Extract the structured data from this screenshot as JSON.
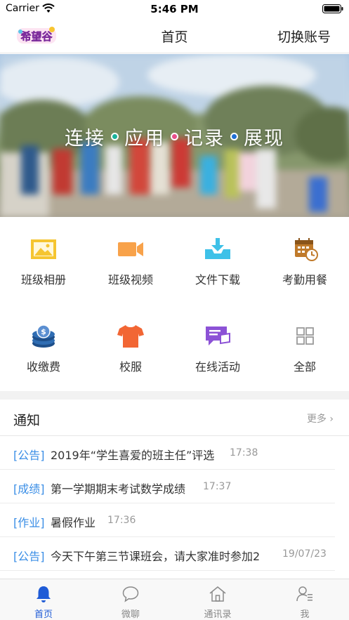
{
  "status_bar": {
    "carrier": "Carrier",
    "time": "5:46 PM"
  },
  "nav": {
    "title": "首页",
    "right_action": "切换账号",
    "logo_text": "希望谷"
  },
  "banner": {
    "words": [
      "连接",
      "应用",
      "记录",
      "展现"
    ],
    "dot_colors": [
      "#19b39a",
      "#e94f8a",
      "#1f6fd6"
    ]
  },
  "grid": [
    {
      "label": "班级相册",
      "icon": "photo-album-icon",
      "color": "#f5c531"
    },
    {
      "label": "班级视频",
      "icon": "video-camera-icon",
      "color": "#f8a24a"
    },
    {
      "label": "文件下载",
      "icon": "download-tray-icon",
      "color": "#3ec1e8"
    },
    {
      "label": "考勤用餐",
      "icon": "calendar-clock-icon",
      "color": "#c07a2a"
    },
    {
      "label": "收缴费",
      "icon": "coins-icon",
      "color": "#2f6db3"
    },
    {
      "label": "校服",
      "icon": "tshirt-icon",
      "color": "#f26634"
    },
    {
      "label": "在线活动",
      "icon": "chat-flag-icon",
      "color": "#8c52d6"
    },
    {
      "label": "全部",
      "icon": "grid-icon",
      "color": "#9a9a9a"
    }
  ],
  "notice": {
    "title": "通知",
    "more": "更多",
    "items": [
      {
        "tag": "[公告]",
        "text": "2019年“学生喜爱的班主任”评选",
        "time": "17:38"
      },
      {
        "tag": "[成绩]",
        "text": "第一学期期末考试数学成绩",
        "time": "17:37"
      },
      {
        "tag": "[作业]",
        "text": "暑假作业",
        "time": "17:36"
      },
      {
        "tag": "[公告]",
        "text": "今天下午第三节课班会，请大家准时参加2",
        "time": "19/07/23"
      }
    ]
  },
  "tabs": [
    {
      "label": "首页",
      "icon": "bell-icon",
      "active": true
    },
    {
      "label": "微聊",
      "icon": "chat-bubble-icon",
      "active": false
    },
    {
      "label": "通讯录",
      "icon": "house-icon",
      "active": false
    },
    {
      "label": "我",
      "icon": "profile-list-icon",
      "active": false
    }
  ],
  "colors": {
    "accent": "#1f5bd6",
    "tag_blue": "#3a8ee6"
  }
}
